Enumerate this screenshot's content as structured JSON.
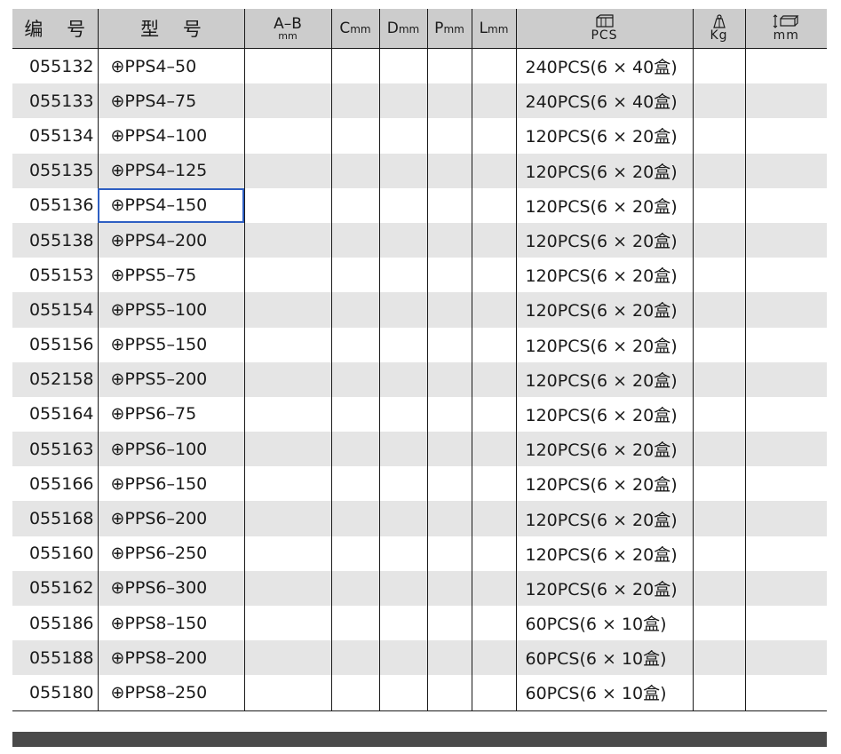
{
  "headers": {
    "code": "编 号",
    "model": "型 号",
    "ab_top": "A–B",
    "ab_bottom": "mm",
    "c_letter": "C",
    "c_unit": "mm",
    "d_letter": "D",
    "d_unit": "mm",
    "p_letter": "P",
    "p_unit": "mm",
    "l_letter": "L",
    "l_unit": "mm",
    "pcs": "PCS",
    "pcs_icon": "box-icon",
    "kg": "Kg",
    "kg_icon": "weight-icon",
    "size": "mm",
    "size_icon": "carton-size-icon"
  },
  "selected_row": 4,
  "rows": [
    {
      "code": "055132",
      "model": "⊕PPS4–50",
      "pcs": "240PCS(6 × 40盒)"
    },
    {
      "code": "055133",
      "model": "⊕PPS4–75",
      "pcs": "240PCS(6 × 40盒)"
    },
    {
      "code": "055134",
      "model": "⊕PPS4–100",
      "pcs": "120PCS(6 × 20盒)"
    },
    {
      "code": "055135",
      "model": "⊕PPS4–125",
      "pcs": "120PCS(6 × 20盒)"
    },
    {
      "code": "055136",
      "model": "⊕PPS4–150",
      "pcs": "120PCS(6 × 20盒)"
    },
    {
      "code": "055138",
      "model": "⊕PPS4–200",
      "pcs": "120PCS(6 × 20盒)"
    },
    {
      "code": "055153",
      "model": "⊕PPS5–75",
      "pcs": "120PCS(6 × 20盒)"
    },
    {
      "code": "055154",
      "model": "⊕PPS5–100",
      "pcs": "120PCS(6 × 20盒)"
    },
    {
      "code": "055156",
      "model": "⊕PPS5–150",
      "pcs": "120PCS(6 × 20盒)"
    },
    {
      "code": "052158",
      "model": "⊕PPS5–200",
      "pcs": "120PCS(6 × 20盒)"
    },
    {
      "code": "055164",
      "model": "⊕PPS6–75",
      "pcs": "120PCS(6 × 20盒)"
    },
    {
      "code": "055163",
      "model": "⊕PPS6–100",
      "pcs": "120PCS(6 × 20盒)"
    },
    {
      "code": "055166",
      "model": "⊕PPS6–150",
      "pcs": "120PCS(6 × 20盒)"
    },
    {
      "code": "055168",
      "model": "⊕PPS6–200",
      "pcs": "120PCS(6 × 20盒)"
    },
    {
      "code": "055160",
      "model": "⊕PPS6–250",
      "pcs": "120PCS(6 × 20盒)"
    },
    {
      "code": "055162",
      "model": "⊕PPS6–300",
      "pcs": "120PCS(6 × 20盒)"
    },
    {
      "code": "055186",
      "model": "⊕PPS8–150",
      "pcs": "60PCS(6 × 10盒)"
    },
    {
      "code": "055188",
      "model": "⊕PPS8–200",
      "pcs": "60PCS(6 × 10盒)"
    },
    {
      "code": "055180",
      "model": "⊕PPS8–250",
      "pcs": "60PCS(6 × 10盒)"
    }
  ]
}
